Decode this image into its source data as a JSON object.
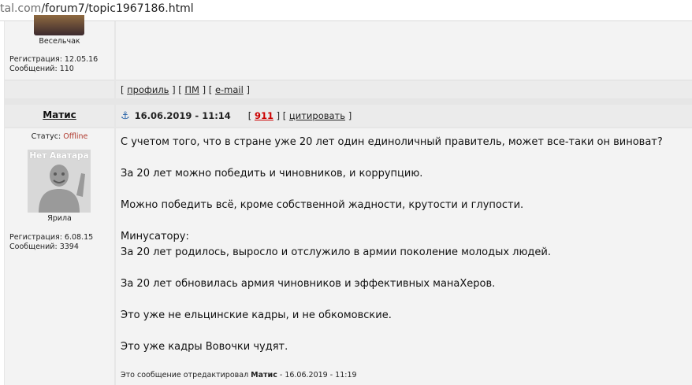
{
  "browser": {
    "url_prefix": "tal.com",
    "url_path": "/forum7/topic1967186.html"
  },
  "prev_post": {
    "rank": "Весельчак",
    "registration": "Регистрация: 12.05.16",
    "messages": "Сообщений: 110",
    "links": {
      "open1": "[",
      "profile": "профиль",
      "sep1": "] [",
      "pm": "ПМ",
      "sep2": "] [",
      "email": "e-mail",
      "close": "]"
    }
  },
  "post": {
    "author": "Матис",
    "date": "16.06.2019 - 11:14",
    "rating_open": "[",
    "rating": "911",
    "rating_sep": "] [",
    "quote": "цитировать",
    "quote_close": "]",
    "status_label": "Статус:",
    "status_value": "Offline",
    "avatar_caption": "Нет Аватара",
    "rank": "Ярила",
    "registration": "Регистрация: 6.08.15",
    "messages": "Сообщений: 3394",
    "lines": [
      "С учетом того, что в стране уже 20 лет один единоличный правитель, может все-таки он виноват?",
      "",
      "За 20 лет можно победить и чиновников, и коррупцию.",
      "",
      "Можно победить всё, кроме собственной жадности, крутости и глупости.",
      "",
      "Минусатору:",
      "За 20 лет родилось, выросло и отслужило в армии поколение молодых людей.",
      "",
      "За 20 лет обновилась армия чиновников и эффективных манаХеров.",
      "",
      "Это уже не ельцинские кадры, и не обкомовские.",
      "",
      "Это уже кадры Вовочки чудят."
    ],
    "edited_prefix": "Это сообщение отредактировал",
    "edited_author": "Матис",
    "edited_suffix": "- 16.06.2019 - 11:19"
  }
}
